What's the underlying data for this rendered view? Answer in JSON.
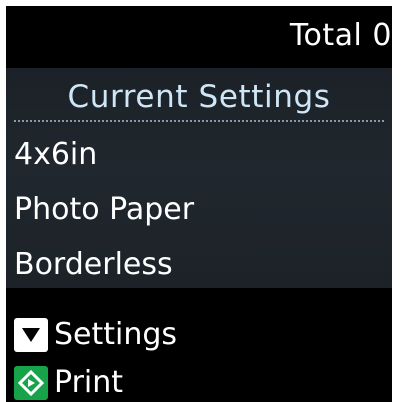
{
  "status": {
    "total_label": "Total 0"
  },
  "current_settings": {
    "title": "Current Settings",
    "items": [
      {
        "label": "4x6in"
      },
      {
        "label": "Photo Paper"
      },
      {
        "label": "Borderless"
      }
    ]
  },
  "footer": {
    "settings_label": "Settings",
    "print_label": "Print"
  },
  "icons": {
    "settings_key": "down-arrow-icon",
    "print_key": "start-diamond-icon"
  },
  "colors": {
    "screen_background": "#000000",
    "panel_background": "#20272e",
    "title_text": "#cfe6f6",
    "text": "#ffffff",
    "print_key": "#17a34a"
  }
}
